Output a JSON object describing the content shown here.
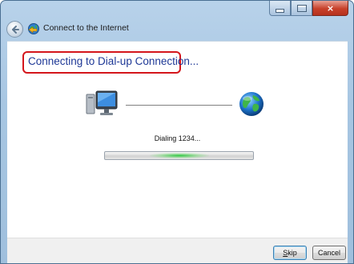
{
  "window": {
    "title": "Connect to the Internet",
    "caption_buttons": {
      "minimize": "minimize",
      "maximize": "maximize",
      "close": "×"
    }
  },
  "main": {
    "heading": "Connecting to Dial-up Connection...",
    "status": "Dialing 1234...",
    "progress": {
      "state": "indeterminate",
      "color": "#2fbf3a"
    }
  },
  "footer": {
    "skip_access_key": "S",
    "skip_rest": "kip",
    "cancel_label": "Cancel"
  },
  "icons": {
    "back": "back-arrow-icon",
    "app": "network-globe-icon",
    "computer": "computer-icon",
    "internet": "globe-icon"
  },
  "colors": {
    "heading": "#1e3896",
    "highlight": "#d4161c",
    "titlebar": "#a7c6e2"
  }
}
